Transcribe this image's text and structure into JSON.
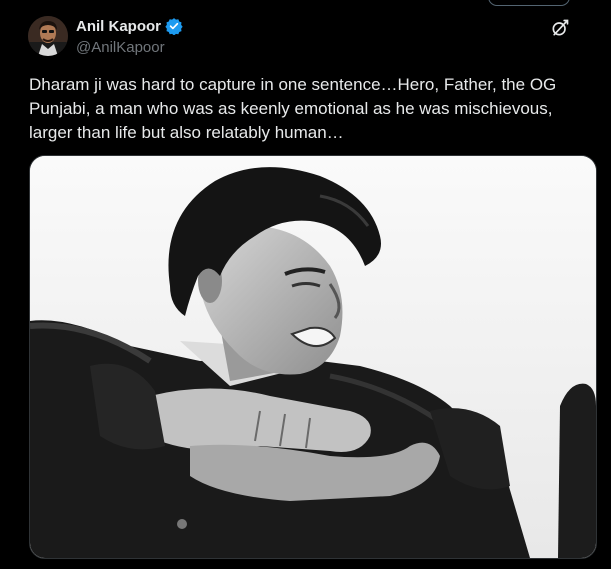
{
  "author": {
    "name": "Anil Kapoor",
    "handle": "@AnilKapoor",
    "verified": true,
    "verified_icon": "verified-badge-icon",
    "verified_color": "#1d9bf0"
  },
  "tweet": {
    "text": "Dharam ji was hard to capture in one sentence…Hero, Father, the OG Punjabi, a man who was as keenly emotional as he was mischievous, larger than life but also relatably human…"
  },
  "actions": {
    "grok_icon": "grok-icon"
  },
  "media": {
    "type": "photo",
    "style": "black-and-white",
    "subject": "smiling young man with dark wavy hair, arms folded"
  },
  "colors": {
    "background": "#000000",
    "text": "#e7e9ea",
    "secondary_text": "#71767b",
    "accent": "#1d9bf0"
  }
}
